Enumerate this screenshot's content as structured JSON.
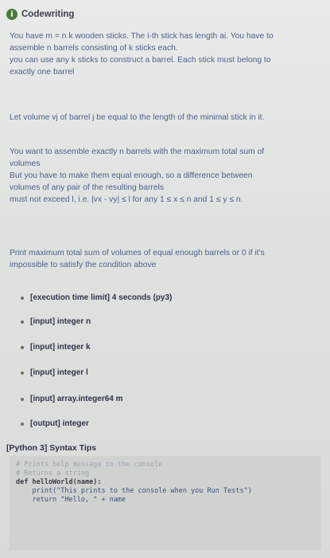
{
  "header": {
    "title": "Codewriting",
    "icon": "info-icon"
  },
  "description": {
    "p1": [
      "You have m = n k wooden sticks. The i-th stick has length ai. You have to",
      "assemble n barrels consisting of k sticks each.",
      "you can use any k sticks to construct a barrel. Each stick must belong to",
      "exactly one barrel"
    ],
    "p2": "Let volume vj of barrel j be equal to the length of the minimal stick in it.",
    "p3": [
      "You want to assemble exactly n barrels with the maximum total sum of",
      "volumes",
      "But you have to make them equal enough, so a difference between",
      "volumes of any pair of the resulting barrels",
      "must not exceed l, i.e. |vx - vy| ≤ l for any 1 ≤ x ≤ n and 1 ≤ y ≤ n."
    ],
    "p4": [
      "Print maximum total sum of volumes of equal enough barrels or 0 if it's",
      "impossible to satisfy the condition above"
    ]
  },
  "specs": [
    "[execution time limit] 4 seconds (py3)",
    "[input] integer n",
    "[input] integer k",
    "[input] integer l",
    "[input] array.integer64 m",
    "[output] integer"
  ],
  "tips": {
    "title": "[Python 3] Syntax Tips",
    "code": [
      "# Prints help message to the console",
      "# Returns a string",
      "def helloWorld(name):",
      "    print(\"This prints to the console when you Run Tests\")",
      "    return \"Hello, \" + name"
    ]
  }
}
